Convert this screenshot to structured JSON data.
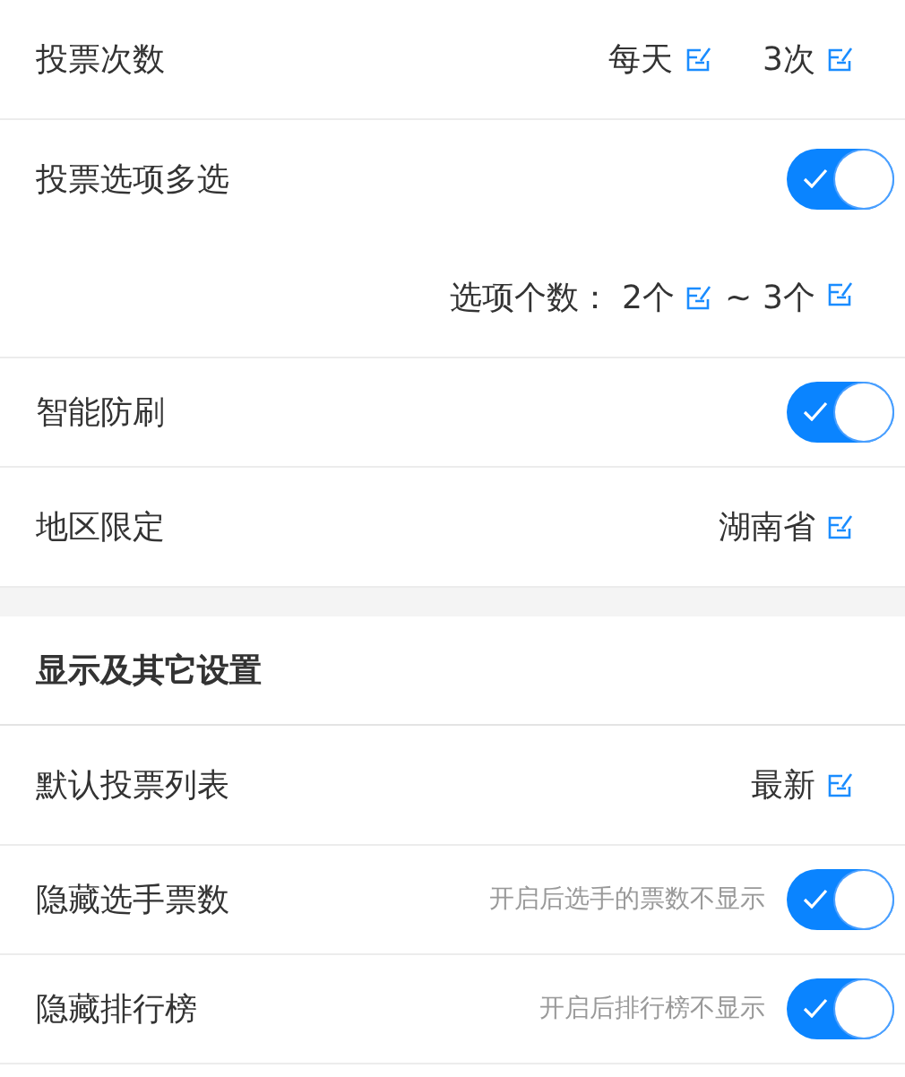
{
  "groups": [
    {
      "rows": [
        {
          "kind": "values",
          "label": "投票次数",
          "values": [
            "每天",
            "3次"
          ]
        },
        {
          "kind": "toggle",
          "label": "投票选项多选",
          "on": true
        },
        {
          "kind": "range",
          "label": "选项个数：",
          "values": [
            "2个",
            "3个"
          ],
          "separator": "~"
        },
        {
          "kind": "toggle",
          "label": "智能防刷",
          "on": true
        },
        {
          "kind": "values",
          "label": "地区限定",
          "values": [
            "湖南省"
          ]
        }
      ]
    },
    {
      "title": "显示及其它设置",
      "rows": [
        {
          "kind": "values",
          "label": "默认投票列表",
          "values": [
            "最新"
          ]
        },
        {
          "kind": "toggle",
          "label": "隐藏选手票数",
          "hint": "开启后选手的票数不显示",
          "on": true
        },
        {
          "kind": "toggle",
          "label": "隐藏排行榜",
          "hint": "开启后排行榜不显示",
          "on": true
        }
      ]
    }
  ]
}
